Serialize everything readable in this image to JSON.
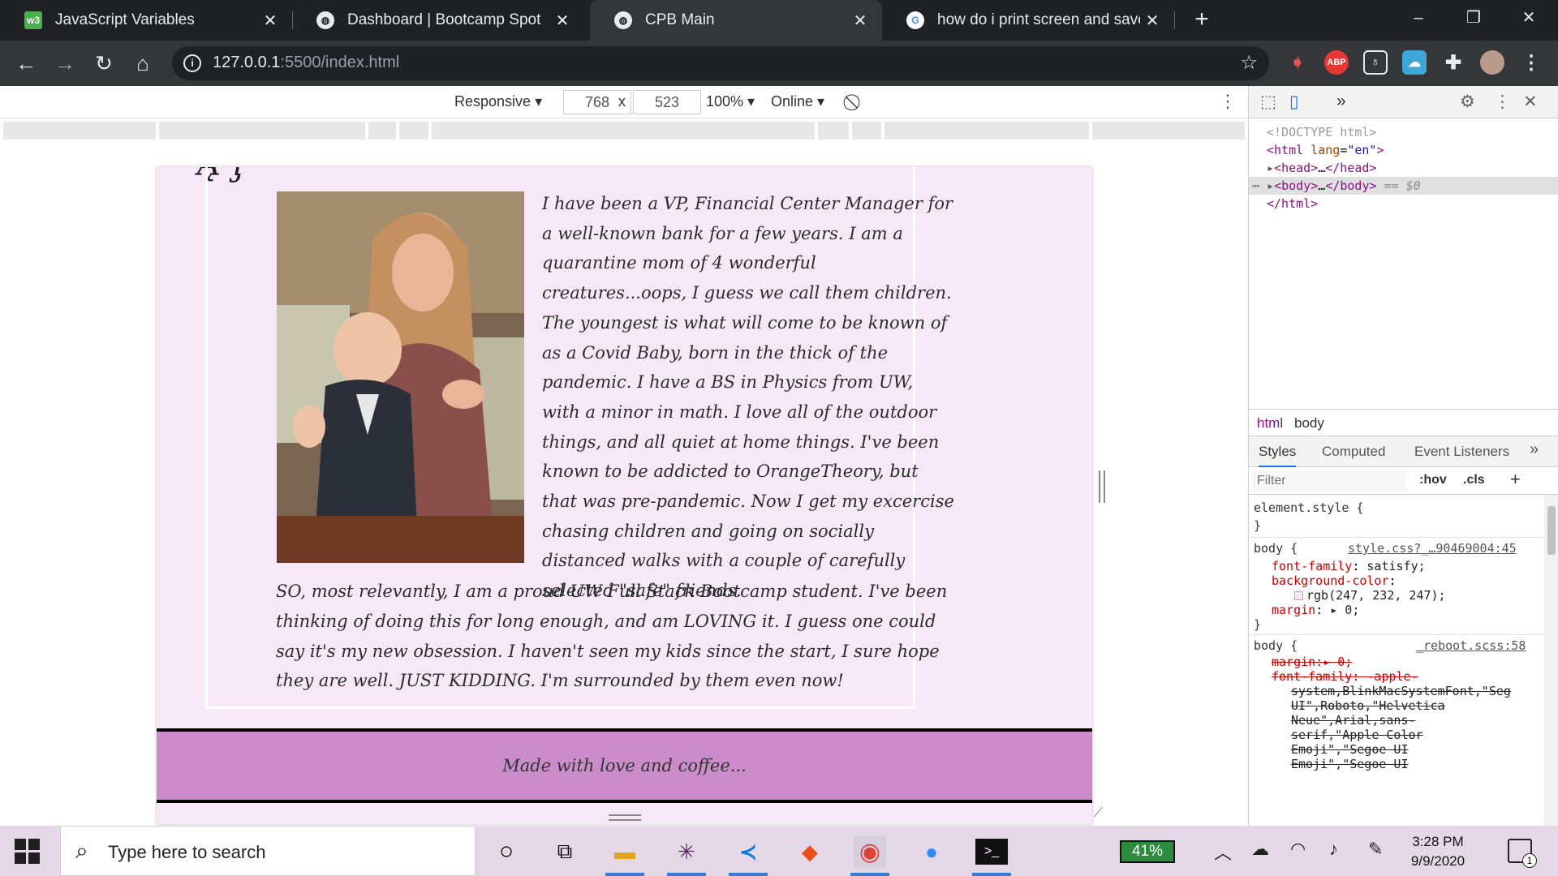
{
  "browser": {
    "tabs": [
      {
        "title": "JavaScript Variables",
        "favicon": "w3schools-icon"
      },
      {
        "title": "Dashboard | Bootcamp Spot",
        "favicon": "globe-icon"
      },
      {
        "title": "CPB Main",
        "favicon": "globe-icon",
        "active": true
      },
      {
        "title": "how do i print screen and save to",
        "favicon": "google-icon"
      }
    ],
    "new_tab": "+",
    "url_host": "127.0.0.1",
    "url_rest": ":5500/index.html",
    "extensions": [
      "record-icon",
      "ABP",
      "bulb-icon",
      "cloud-icon",
      "puzzle-icon",
      "profile-avatar",
      "menu-icon"
    ]
  },
  "device_toolbar": {
    "mode": "Responsive",
    "width": "768",
    "times": "x",
    "height": "523",
    "zoom": "100%",
    "network": "Online"
  },
  "page": {
    "about_paragraph_1": "I have been a VP, Financial Center Manager for a well-known bank for a few years. I am a quarantine mom of 4 wonderful creatures...oops, I guess we call them children. The youngest is what will come to be known of as a Covid Baby, born in the thick of the pandemic. I have a BS in Physics from UW, with a minor in math. I love all of the outdoor things, and all quiet at home things. I've been known to be addicted to OrangeTheory, but that was pre-pandemic. Now I get my excercise chasing children and going on socially distanced walks with a couple of carefully selected \"safe\" friends.",
    "about_paragraph_2": "SO, most relevantly, I am a proud UW Full Stack Bootcamp student. I've been thinking of doing this for long enough, and am LOVING it. I guess one could say it's my new obsession. I haven't seen my kids since the start, I sure hope they are well. JUST KIDDING. I'm surrounded by them even now!",
    "footer": "Made with love and coffee...",
    "bg_color": "#f7e8f7",
    "footer_color": "#cc8ccc"
  },
  "devtools": {
    "elements": {
      "doctype": "<!DOCTYPE html>",
      "html_open_tag": "html",
      "html_attr": "lang",
      "html_attr_val": "\"en\"",
      "head": "head",
      "head_close": "</head>",
      "body": "body",
      "body_close": "</body>",
      "body_selected_hint": "== $0",
      "html_close": "</html>"
    },
    "breadcrumbs": [
      "html",
      "body"
    ],
    "subtabs": [
      "Styles",
      "Computed",
      "Event Listeners"
    ],
    "more_tabs": "»",
    "filter_placeholder": "Filter",
    "hov": ":hov",
    "cls": ".cls",
    "add": "+",
    "styles": {
      "element_style": "element.style {",
      "close_brace": "}",
      "rule1_selector": "body {",
      "rule1_source": "style.css?_…90469004:45",
      "rule1_props": [
        {
          "name": "font-family",
          "value": "satisfy;"
        },
        {
          "name": "background-color",
          "value": ""
        },
        {
          "name": "",
          "value": "rgb(247, 232, 247);"
        },
        {
          "name": "margin",
          "value": "▸ 0;"
        }
      ],
      "rule2_selector": "body {",
      "rule2_source": "_reboot.scss:58",
      "rule2_margin": "margin:▸ 0;",
      "rule2_ff_name": "font-family: -apple-",
      "rule2_ff_lines": [
        "system,BlinkMacSystemFont,\"Seg",
        "UI\",Roboto,\"Helvetica",
        "Neue\",Arial,sans-",
        "serif,\"Apple Color",
        "Emoji\",\"Segoe UI",
        "Emoji\",\"Segoe UI"
      ]
    }
  },
  "taskbar": {
    "search_placeholder": "Type here to search",
    "battery": "41%",
    "time": "3:28 PM",
    "date": "9/9/2020",
    "notification_count": "1"
  }
}
